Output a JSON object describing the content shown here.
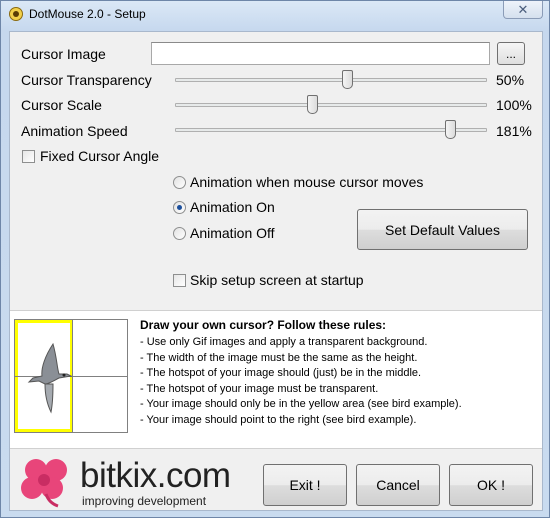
{
  "window": {
    "title": "DotMouse 2.0 - Setup",
    "close_glyph": "✕"
  },
  "settings": {
    "cursor_image_label": "Cursor Image",
    "cursor_image_value": "",
    "browse_label": "...",
    "sliders": [
      {
        "label": "Cursor Transparency",
        "value_text": "50%",
        "level": 0.55
      },
      {
        "label": "Cursor Scale",
        "value_text": "100%",
        "level": 0.44
      },
      {
        "label": "Animation Speed",
        "value_text": "181%",
        "level": 0.88
      }
    ],
    "fixed_angle_label": "Fixed Cursor Angle",
    "fixed_angle_checked": false
  },
  "animation": {
    "options": [
      {
        "label": "Animation when mouse cursor moves",
        "selected": false
      },
      {
        "label": "Animation On",
        "selected": true
      },
      {
        "label": "Animation Off",
        "selected": false
      }
    ],
    "default_button": "Set Default Values",
    "skip_label": "Skip setup screen at startup",
    "skip_checked": false
  },
  "help": {
    "title": "Draw your own cursor? Follow these rules:",
    "rules": [
      "- Use only Gif images and apply a transparent background.",
      "- The width of the image must be the same as the height.",
      "- The hotspot of your image should (just) be in the middle.",
      "- The hotspot of your image must be transparent.",
      "- Your image should only be in the yellow area (see bird example).",
      "- Your image should point to the right (see bird example)."
    ]
  },
  "logo": {
    "text": "bitkix.com",
    "tagline": "improving development"
  },
  "footer": {
    "exit_label": "Exit !",
    "cancel_label": "Cancel",
    "ok_label": "OK !"
  },
  "colors": {
    "accent_yellow": "#ffff00",
    "logo_pink": "#e8457a"
  }
}
